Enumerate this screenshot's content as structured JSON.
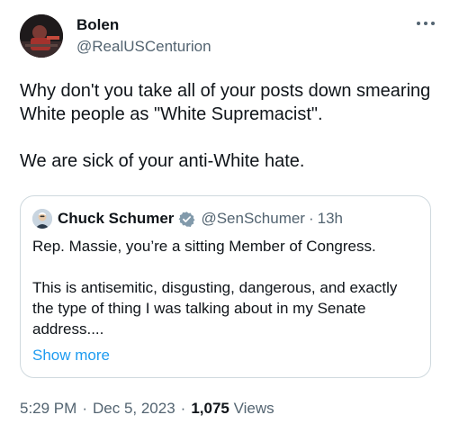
{
  "author": {
    "name": "Bolen",
    "handle": "@RealUSCenturion"
  },
  "tweet": {
    "line1": "Why don't you take all of your posts down smearing White people as \"White Supremacist\".",
    "line2": "We are sick of your anti-White hate."
  },
  "quoted": {
    "name": "Chuck Schumer",
    "handle": "@SenSchumer",
    "separator": "·",
    "time": "13h",
    "para1": "Rep. Massie, you’re a sitting Member of Congress.",
    "para2": "This is antisemitic, disgusting, dangerous, and exactly the type of thing I was talking about in my Senate address....",
    "show_more": "Show more",
    "badge_icon": "verified-badge-icon",
    "badge_color": "#829aab"
  },
  "meta": {
    "time": "5:29 PM",
    "sep1": "·",
    "date": "Dec 5, 2023",
    "sep2": "·",
    "views_count": "1,075",
    "views_label": "Views"
  },
  "colors": {
    "text": "#0f1419",
    "secondary": "#536471",
    "link": "#1d9bf0",
    "border": "#cfd9de"
  }
}
